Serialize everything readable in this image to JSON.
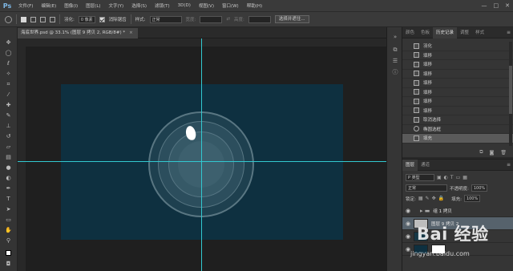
{
  "app": {
    "logo": "Ps"
  },
  "menu": [
    "文件(F)",
    "编辑(E)",
    "图像(I)",
    "图层(L)",
    "文字(Y)",
    "选择(S)",
    "滤镜(T)",
    "3D(D)",
    "视图(V)",
    "窗口(W)",
    "帮助(H)"
  ],
  "window_controls": [
    "—",
    "□",
    "✕"
  ],
  "options": {
    "feather_label": "羽化:",
    "feather_value": "0 像素",
    "antialias_label": "消除锯齿",
    "style_label": "样式:",
    "style_value": "正常",
    "width_label": "宽度:",
    "height_label": "高度:",
    "select_mask_button": "选择并遮住..."
  },
  "document_tab": {
    "title": "海底世界.psd @ 33.1% (图层 9 拷贝 2, RGB/8#) *",
    "close": "×"
  },
  "history_panel": {
    "tabs": [
      "颜色",
      "色板",
      "历史记录",
      "调整",
      "样式"
    ],
    "active_tab": 2,
    "items": [
      {
        "label": "羽化",
        "icon": "layer"
      },
      {
        "label": "填移",
        "icon": "layer"
      },
      {
        "label": "填移",
        "icon": "layer"
      },
      {
        "label": "填移",
        "icon": "layer"
      },
      {
        "label": "填移",
        "icon": "layer"
      },
      {
        "label": "填移",
        "icon": "layer"
      },
      {
        "label": "填移",
        "icon": "layer"
      },
      {
        "label": "填移",
        "icon": "layer"
      },
      {
        "label": "取消选择",
        "icon": "layer"
      },
      {
        "label": "椭圆选框",
        "icon": "ellipse"
      },
      {
        "label": "填充",
        "icon": "layer",
        "selected": true
      }
    ]
  },
  "layers_panel": {
    "tabs": [
      "图层",
      "通道"
    ],
    "active_tab": 0,
    "filter_label": "P 类型",
    "blend_mode": "正常",
    "opacity_label": "不透明度:",
    "opacity_value": "100%",
    "lock_label": "锁定:",
    "fill_label": "填充:",
    "fill_value": "100%",
    "layers": [
      {
        "name": "组 1 拷贝",
        "type": "group"
      },
      {
        "name": "图层 9 拷贝 2",
        "type": "layer",
        "selected": true
      }
    ]
  },
  "watermark": {
    "text": "Bai 经验",
    "subtext": "jingyan.baidu.com"
  },
  "colors": {
    "guide": "#32c8d0",
    "panel_fill": "#0e3040",
    "selection": "#56626c"
  }
}
